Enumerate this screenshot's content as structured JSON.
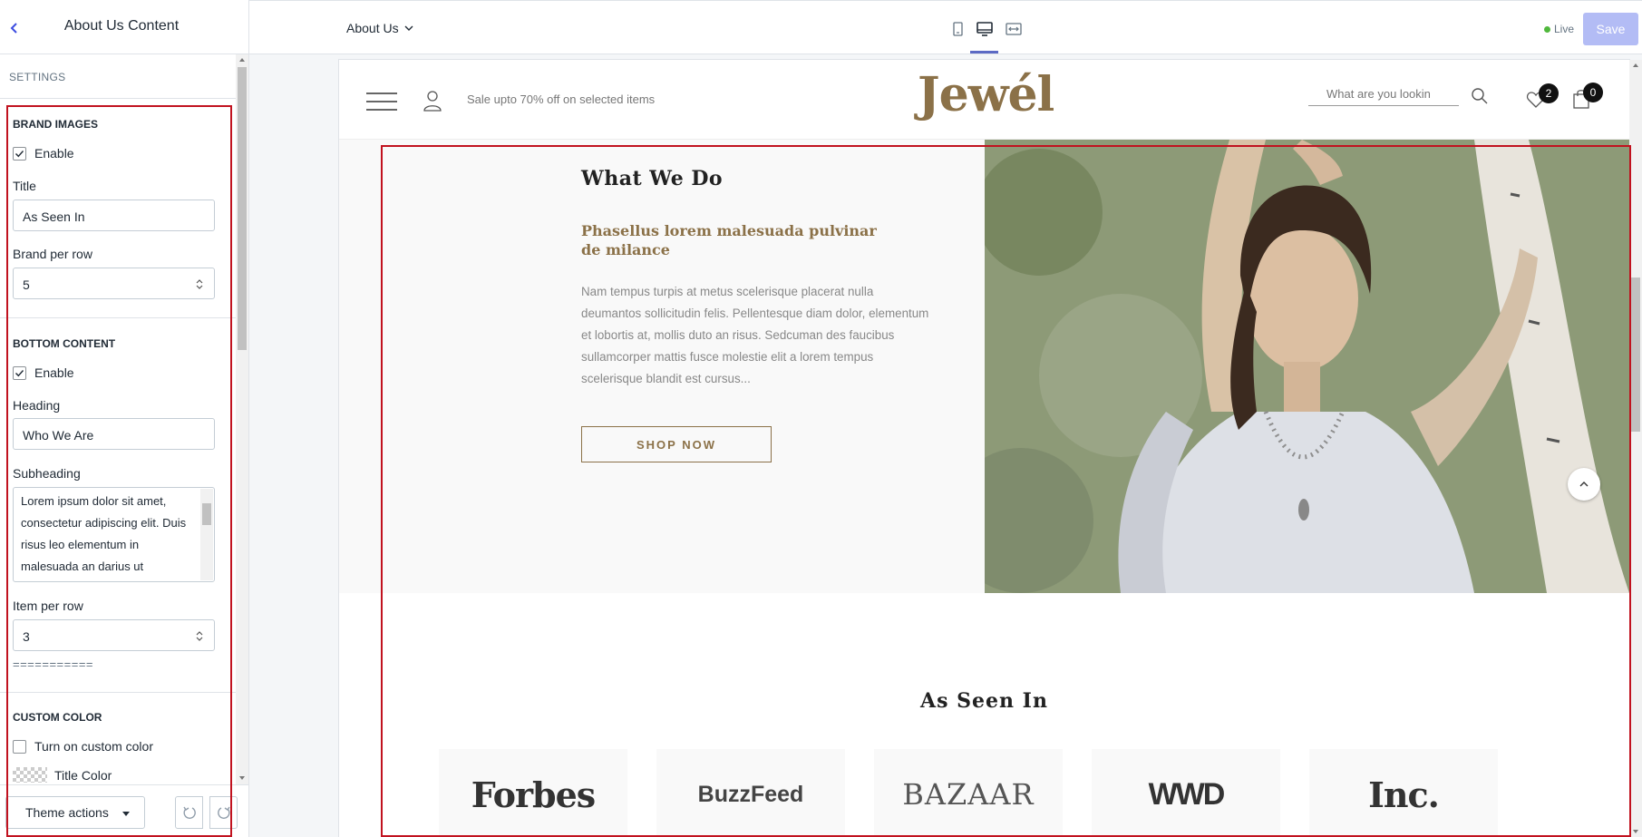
{
  "sidebar": {
    "title": "About Us Content",
    "settings_label": "SETTINGS",
    "brand_images": {
      "heading": "BRAND IMAGES",
      "enable_label": "Enable",
      "enable_checked": true,
      "title_label": "Title",
      "title_value": "As Seen In",
      "brand_per_row_label": "Brand per row",
      "brand_per_row_value": "5"
    },
    "bottom_content": {
      "heading": "BOTTOM CONTENT",
      "enable_label": "Enable",
      "enable_checked": true,
      "heading_label": "Heading",
      "heading_value": "Who We Are",
      "subheading_label": "Subheading",
      "subheading_value": "Lorem ipsum dolor sit amet, consectetur adipiscing elit. Duis risus leo elementum in malesuada an darius ut",
      "item_per_row_label": "Item per row",
      "item_per_row_value": "3",
      "separator": "==========="
    },
    "custom_color": {
      "heading": "CUSTOM COLOR",
      "toggle_label": "Turn on custom color",
      "toggle_checked": false,
      "title_color_label": "Title Color"
    },
    "footer": {
      "theme_actions_label": "Theme actions"
    }
  },
  "topbar": {
    "page_select": "About Us",
    "viewports": [
      "mobile-icon",
      "desktop-icon",
      "fullwidth-icon"
    ],
    "active_viewport": "desktop",
    "status": "Live",
    "save_label": "Save"
  },
  "preview": {
    "header": {
      "promo": "Sale upto 70% off on selected items",
      "logo": "Jewél",
      "search_placeholder": "What are you lookin",
      "wishlist_count": "2",
      "cart_count": "0"
    },
    "what_we_do": {
      "heading": "What We Do",
      "subheading": "Phasellus lorem malesuada pulvinar de milance",
      "body": "Nam tempus turpis at metus scelerisque placerat nulla deumantos sollicitudin felis. Pellentesque diam dolor, elementum et lobortis at, mollis duto an risus. Sedcuman des faucibus sullamcorper mattis fusce molestie elit a lorem tempus scelerisque blandit est cursus...",
      "button": "SHOP NOW"
    },
    "as_seen_in": {
      "heading": "As Seen In",
      "brands": [
        "Forbes",
        "BuzzFeed",
        "BAZAAR",
        "WWD",
        "Inc."
      ]
    }
  },
  "colors": {
    "accent": "#8b7148",
    "save_disabled": "#b3bcf5",
    "selection": "#c1121f",
    "live_dot": "#50b83c"
  }
}
